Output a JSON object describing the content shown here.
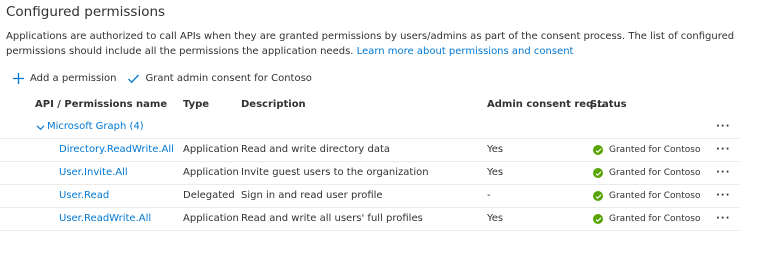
{
  "heading": "Configured permissions",
  "description": {
    "text": "Applications are authorized to call APIs when they are granted permissions by users/admins as part of the consent process. The list of configured permissions should include all the permissions the application needs.",
    "link": "Learn more about permissions and consent"
  },
  "toolbar": {
    "add_label": "Add a permission",
    "grant_label": "Grant admin consent for Contoso"
  },
  "table": {
    "headers": {
      "name": "API / Permissions name",
      "type": "Type",
      "description": "Description",
      "admin": "Admin consent req...",
      "status": "Status"
    },
    "group": "Microsoft Graph (4)",
    "rows": [
      {
        "name": "Directory.ReadWrite.All",
        "type": "Application",
        "description": "Read and write directory data",
        "admin": "Yes",
        "status": "Granted for Contoso"
      },
      {
        "name": "User.Invite.All",
        "type": "Application",
        "description": "Invite guest users to the organization",
        "admin": "Yes",
        "status": "Granted for Contoso"
      },
      {
        "name": "User.Read",
        "type": "Delegated",
        "description": "Sign in and read user profile",
        "admin": "-",
        "status": "Granted for Contoso"
      },
      {
        "name": "User.ReadWrite.All",
        "type": "Application",
        "description": "Read and write all users' full profiles",
        "admin": "Yes",
        "status": "Granted for Contoso"
      }
    ],
    "more_label": "···"
  },
  "colors": {
    "link": "#0078d4",
    "granted": "#57a300",
    "text": "#323130",
    "divider": "#edebe9"
  },
  "icons": [
    "plus-icon",
    "checkmark-icon",
    "chevron-down-icon",
    "granted-check-icon",
    "more-icon"
  ]
}
